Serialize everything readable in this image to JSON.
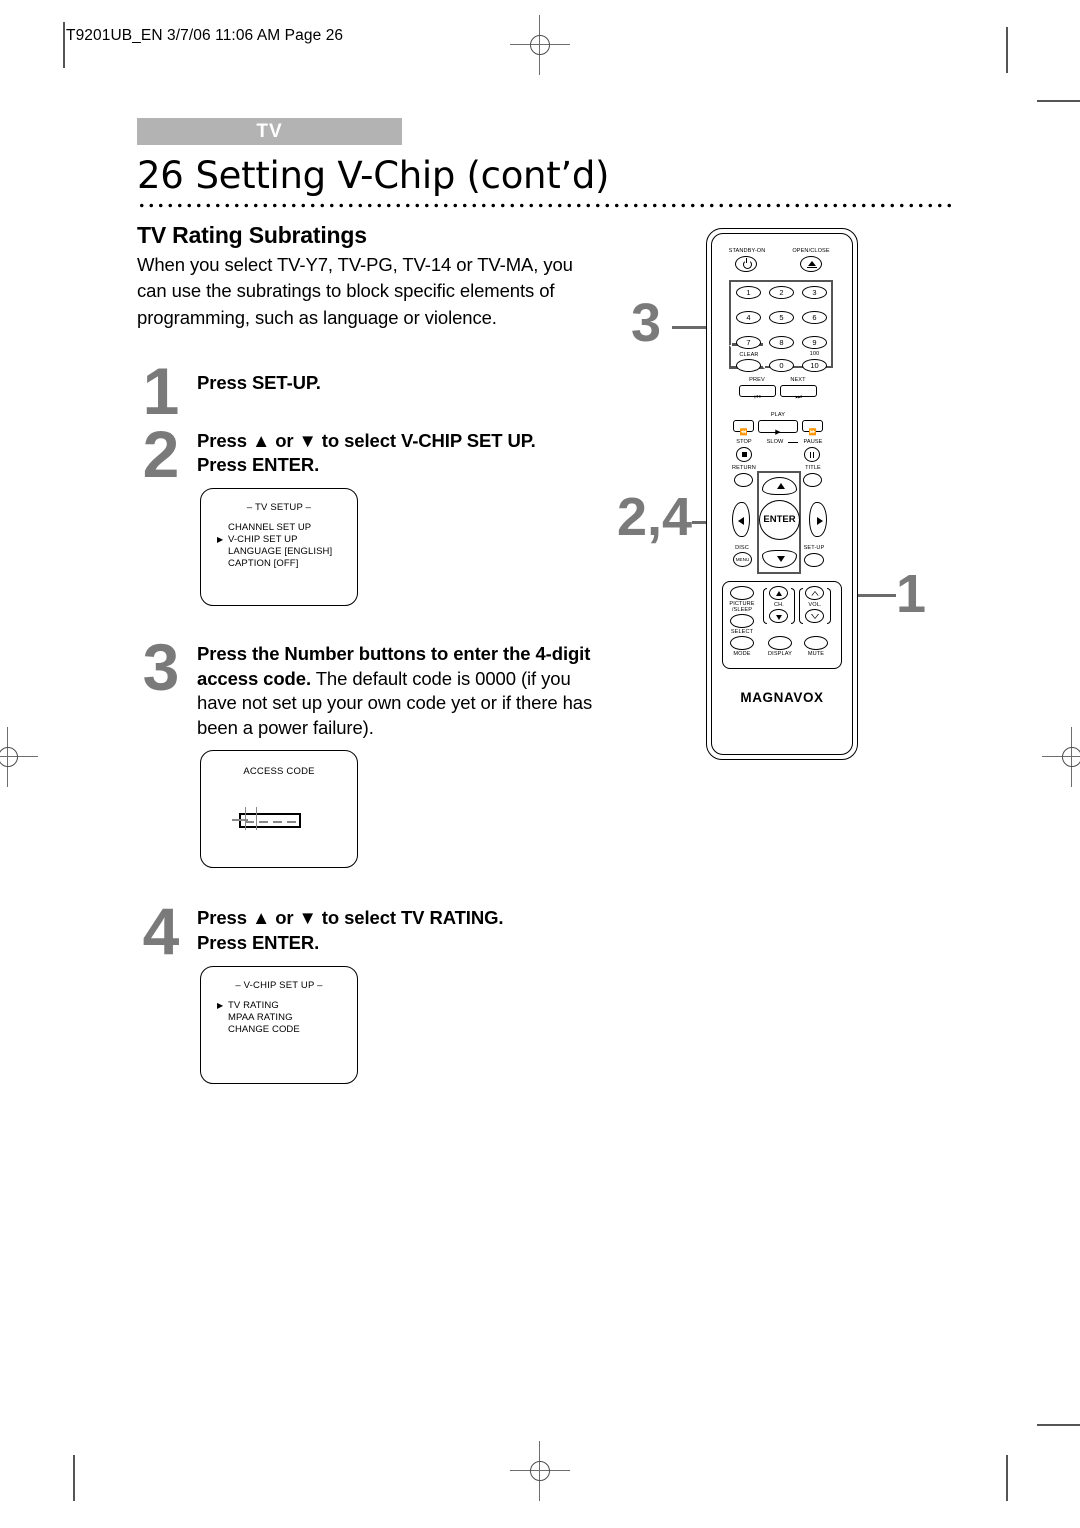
{
  "print_slug": "T9201UB_EN 3/7/06 11:06 AM Page 26",
  "header": {
    "tab_label": "TV",
    "page_number": "26",
    "title": "Setting V-Chip (cont’d)"
  },
  "section": {
    "heading": "TV Rating Subratings",
    "intro": "When you select TV-Y7, TV-PG, TV-14 or TV-MA, you can use the subratings to block specific elements of programming, such as language or violence."
  },
  "steps": [
    {
      "number": "1",
      "text_bold": "Press SET-UP.",
      "text_rest": ""
    },
    {
      "number": "2",
      "line1": "Press ▲ or ▼ to select V-CHIP SET UP.",
      "line2": "Press ENTER."
    },
    {
      "number": "3",
      "text_bold": "Press the Number buttons to enter the 4-digit access code.",
      "text_rest": " The default code is 0000 (if you have not set up your own code yet or if there has been a power failure)."
    },
    {
      "number": "4",
      "line1": "Press ▲ or ▼ to select TV RATING.",
      "line2": "Press ENTER."
    }
  ],
  "osd_tv_setup": {
    "title": "– TV SETUP –",
    "items": [
      {
        "label": "CHANNEL SET UP",
        "selected": false
      },
      {
        "label": "V-CHIP SET UP",
        "selected": true
      },
      {
        "label": "LANGUAGE  [ENGLISH]",
        "selected": false
      },
      {
        "label": "CAPTION  [OFF]",
        "selected": false
      }
    ]
  },
  "osd_access_code": {
    "title": "ACCESS CODE",
    "digits": "- - - -"
  },
  "osd_vchip_setup": {
    "title": "– V-CHIP SET UP –",
    "items": [
      {
        "label": "TV RATING",
        "selected": true
      },
      {
        "label": "MPAA RATING",
        "selected": false
      },
      {
        "label": "CHANGE CODE",
        "selected": false
      }
    ]
  },
  "callouts": {
    "number_pad": "3",
    "cursor_pad": "2,4",
    "setup_button": "1"
  },
  "remote": {
    "brand": "MAGNAVOX",
    "standby_label": "STANDBY-ON",
    "open_close_label": "OPEN/CLOSE",
    "number_keys": [
      "1",
      "2",
      "3",
      "4",
      "5",
      "6",
      "7",
      "8",
      "9",
      "0",
      "10"
    ],
    "hundred_label": "100",
    "clear_label": "CLEAR",
    "prev_label": "PREV",
    "next_label": "NEXT",
    "play_label": "PLAY",
    "stop_label": "STOP",
    "slow_label": "SLOW",
    "pause_label": "PAUSE",
    "return_label": "RETURN",
    "title_label": "TITLE",
    "enter_label": "ENTER",
    "disc_label": "DISC",
    "disc_sub_label": "MENU",
    "setup_label": "SET-UP",
    "picture_label": "PICTURE",
    "sleep_label": "/SLEEP",
    "select_label": "SELECT",
    "ch_label": "CH.",
    "vol_label": "VOL.",
    "mode_label": "MODE",
    "display_label": "DISPLAY",
    "mute_label": "MUTE"
  },
  "colors": {
    "tab_bg": "#b3b3b3",
    "step_number": "#7a7a7a",
    "highlight": "#555555"
  }
}
